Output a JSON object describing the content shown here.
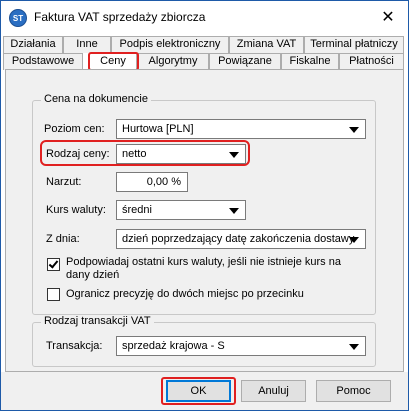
{
  "window": {
    "title": "Faktura VAT sprzedaży zbiorcza",
    "icon_text": "ST",
    "close_symbol": "✕"
  },
  "tabs": {
    "row1": [
      "Działania",
      "Inne",
      "Podpis elektroniczny",
      "Zmiana VAT",
      "Terminal płatniczy"
    ],
    "row2": [
      "Podstawowe",
      "Ceny",
      "Algorytmy",
      "Powiązane",
      "Fiskalne",
      "Płatności"
    ],
    "active": "Ceny"
  },
  "price_group": {
    "title": "Cena na dokumencie",
    "price_level_label": "Poziom cen:",
    "price_level_value": "Hurtowa [PLN]",
    "price_type_label": "Rodzaj ceny:",
    "price_type_value": "netto",
    "markup_label": "Narzut:",
    "markup_value": "0,00 %",
    "rate_label": "Kurs waluty:",
    "rate_value": "średni",
    "date_label": "Z dnia:",
    "date_value": "dzień poprzedzający datę zakończenia dostawy",
    "suggest_rate_label": "Podpowiadaj ostatni kurs waluty, jeśli nie istnieje kurs na dany dzień",
    "suggest_rate_checked": true,
    "limit_precision_label": "Ogranicz precyzję do dwóch miejsc po przecinku",
    "limit_precision_checked": false
  },
  "vat_group": {
    "title": "Rodzaj transakcji VAT",
    "transaction_label": "Transakcja:",
    "transaction_value": "sprzedaż krajowa - S"
  },
  "footer": {
    "ok_label": "OK",
    "cancel_label": "Anuluj",
    "help_label": "Pomoc"
  },
  "colors": {
    "highlight": "#e02020",
    "accent": "#0078d7"
  }
}
